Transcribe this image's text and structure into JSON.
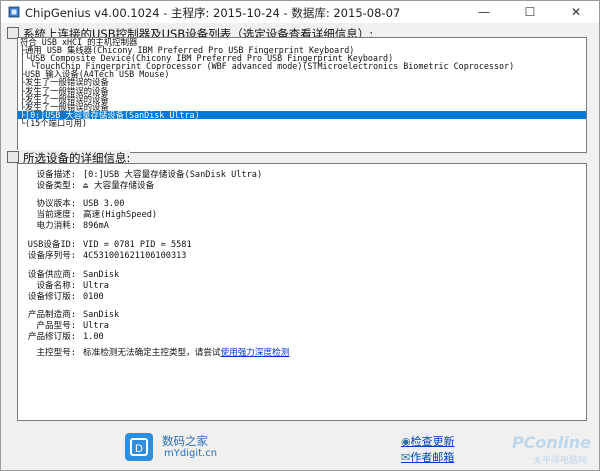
{
  "window": {
    "title": "ChipGenius v4.00.1024 - 主程序: 2015-10-24 - 数据库: 2015-08-07",
    "minimize_glyph": "—",
    "maximize_glyph": "☐",
    "close_glyph": "✕"
  },
  "device_list": {
    "group_title": "系統上连接的USB控制器及USB设备列表（选定设备查看详细信息）:",
    "items": [
      "符合 USB xHCI 的主机控制器",
      "├通用 USB 集线器(Chicony IBM Preferred Pro USB Fingerprint Keyboard)",
      "│└USB Composite Device(Chicony IBM Preferred Pro USB Fingerprint Keyboard)",
      "│ └TouchChip Fingerprint Coprocessor (WBF advanced mode)(STMicroelectronics Biometric Coprocessor)",
      "├USB 输入设备(A4Tech USB Mouse)",
      "├发生了一般错误的设备",
      "├发生了一般错误的设备",
      "├发生了一般错误的设备",
      "├发生了一般错误的设备",
      "├[0:]USB 大容量存储设备(SanDisk Ultra)",
      "└(15个端口可用)"
    ],
    "selected_index": 9
  },
  "details": {
    "group_title": "所选设备的详细信息:",
    "rows": [
      {
        "label": "设备描述:",
        "value": "[0:]USB 大容量存储设备(SanDisk Ultra)"
      },
      {
        "label": "设备类型:",
        "value": "大容量存储设备"
      },
      {
        "label": "协议版本:",
        "value": "USB 3.00"
      },
      {
        "label": "当前速度:",
        "value": "高速(HighSpeed)"
      },
      {
        "label": "电力消耗:",
        "value": "896mA"
      },
      {
        "label": "USB设备ID:",
        "value": "VID = 0781 PID = 5581"
      },
      {
        "label": "设备序列号:",
        "value": "4C531001621106100313"
      },
      {
        "label": "设备供应商:",
        "value": "SanDisk"
      },
      {
        "label": "设备名称:",
        "value": "Ultra"
      },
      {
        "label": "设备修订版:",
        "value": "0100"
      },
      {
        "label": "产品制造商:",
        "value": "SanDisk"
      },
      {
        "label": "产品型号:",
        "value": "Ultra"
      },
      {
        "label": "产品修订版:",
        "value": "1.00"
      }
    ],
    "controller": {
      "label": "主控型号:",
      "text": "标准检测无法确定主控类型，请尝试",
      "link": "使用强力深度检测"
    }
  },
  "footer": {
    "brand_name": "数码之家",
    "brand_url": "mYdigit.cn",
    "check_update": "检查更新",
    "author_email": "作者邮箱",
    "watermark": "PConline",
    "watermark_sub": "太平洋电脑网"
  },
  "colors": {
    "selection": "#0078d7",
    "link": "#0033cc",
    "brand": "#2a6fb5"
  }
}
